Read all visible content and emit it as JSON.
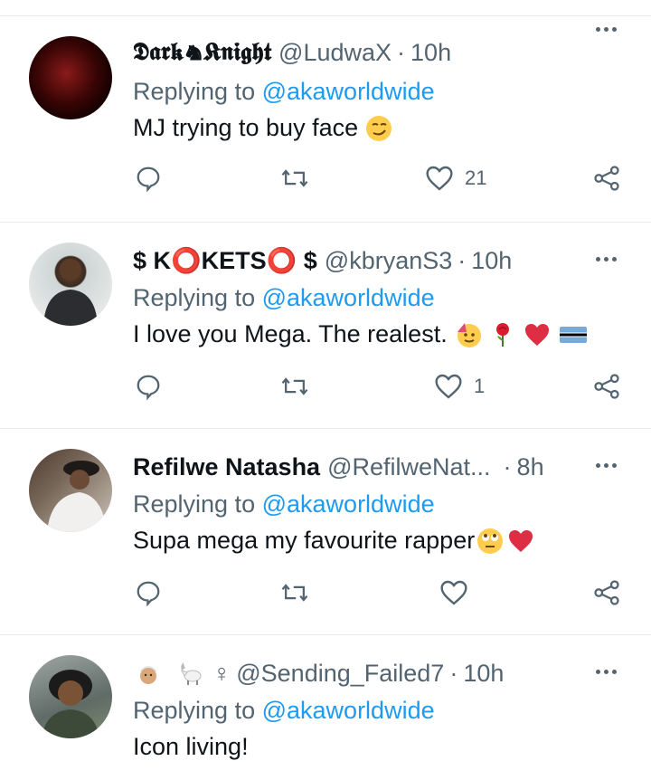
{
  "tweets": [
    {
      "display_name": "𝕯𝖆𝖗𝖐♞𝕶𝖓𝖎𝖌𝖍𝖙",
      "handle": "@LudwaX",
      "time": "10h",
      "replying_prefix": "Replying to",
      "replying_to": "@akaworldwide",
      "text": "MJ trying to buy face",
      "emojis": [
        "smirking-face"
      ],
      "likes": "21"
    },
    {
      "display_name": "$ K⭕KETS⭕ $",
      "handle": "@kbryanS3",
      "time": "10h",
      "replying_prefix": "Replying to",
      "replying_to": "@akaworldwide",
      "text": "I love you Mega. The realest.",
      "emojis": [
        "partying-face",
        "rose",
        "red-heart",
        "botswana-flag"
      ],
      "likes": "1"
    },
    {
      "display_name": "Refilwe Natasha",
      "handle": "@RefilweNat...",
      "time": "8h",
      "replying_prefix": "Replying to",
      "replying_to": "@akaworldwide",
      "text": "Supa mega my favourite rapper",
      "emojis": [
        "face-with-rolling-eyes",
        "red-heart"
      ],
      "likes": ""
    },
    {
      "display_name": "♀",
      "handle": "@Sending_Failed7",
      "time": "10h",
      "replying_prefix": "Replying to",
      "replying_to": "@akaworldwide",
      "text": "Icon living!",
      "emojis": [
        "person-with-turban",
        "goat"
      ],
      "likes": ""
    }
  ],
  "colors": {
    "text_primary": "#0f1419",
    "text_secondary": "#536471",
    "link": "#1d9bf0",
    "divider": "#e7e9ea",
    "heart_red": "#f91880"
  },
  "icons": {
    "reply": "speech-bubble-icon",
    "retweet": "retweet-icon",
    "like": "heart-icon",
    "share": "share-icon",
    "more": "more-dots-icon"
  }
}
